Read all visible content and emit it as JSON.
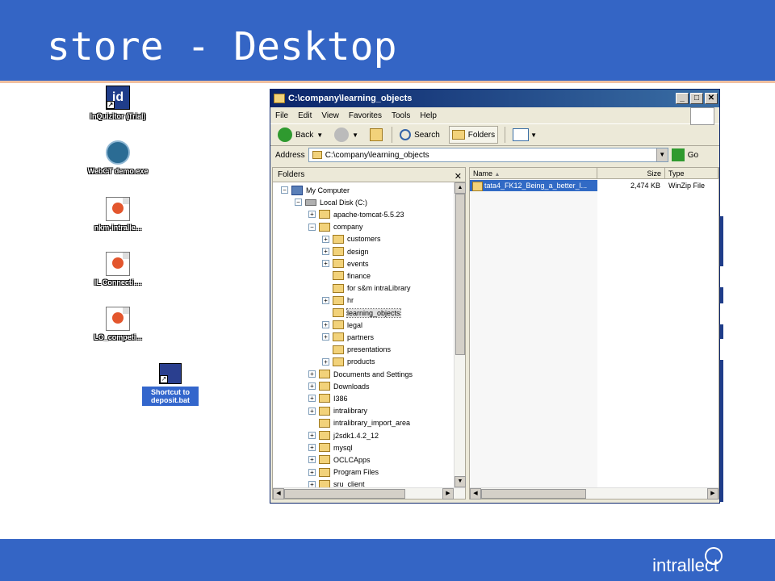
{
  "slide": {
    "title": "store - Desktop",
    "brand": "intrallect"
  },
  "desktop_icons": [
    {
      "label": "InQuizitor (Trial)",
      "icon": "inquizitor-icon"
    },
    {
      "label": "WebCT demo.exe",
      "icon": "webct-icon"
    },
    {
      "label": "nkm-intralle...",
      "icon": "powerpoint-file-icon"
    },
    {
      "label": "IL Connecti....",
      "icon": "powerpoint-file-icon"
    },
    {
      "label": "LO_competi...",
      "icon": "powerpoint-file-icon"
    },
    {
      "label": "Shortcut to deposit.bat",
      "icon": "batch-shortcut-icon"
    }
  ],
  "window": {
    "title": "C:\\company\\learning_objects",
    "menu": [
      "File",
      "Edit",
      "View",
      "Favorites",
      "Tools",
      "Help"
    ],
    "toolbar": {
      "back": "Back",
      "search": "Search",
      "folders": "Folders"
    },
    "address_label": "Address",
    "address_value": "C:\\company\\learning_objects",
    "go": "Go",
    "folders_header": "Folders",
    "columns": {
      "name": "Name",
      "size": "Size",
      "type": "Type"
    },
    "files": [
      {
        "name": "tata4_FK12_Being_a_better_l...",
        "size": "2,474 KB",
        "type": "WinZip File"
      }
    ],
    "tree": [
      {
        "label": "My Computer",
        "level": 0,
        "expander": "-",
        "kind": "computer"
      },
      {
        "label": "Local Disk (C:)",
        "level": 1,
        "expander": "-",
        "kind": "disk"
      },
      {
        "label": "apache-tomcat-5.5.23",
        "level": 2,
        "expander": "+",
        "kind": "folder"
      },
      {
        "label": "company",
        "level": 2,
        "expander": "-",
        "kind": "folder"
      },
      {
        "label": "customers",
        "level": 3,
        "expander": "+",
        "kind": "folder"
      },
      {
        "label": "design",
        "level": 3,
        "expander": "+",
        "kind": "folder"
      },
      {
        "label": "events",
        "level": 3,
        "expander": "+",
        "kind": "folder"
      },
      {
        "label": "finance",
        "level": 3,
        "expander": "",
        "kind": "folder"
      },
      {
        "label": "for s&m intraLibrary",
        "level": 3,
        "expander": "",
        "kind": "folder"
      },
      {
        "label": "hr",
        "level": 3,
        "expander": "+",
        "kind": "folder"
      },
      {
        "label": "learning_objects",
        "level": 3,
        "expander": "",
        "kind": "folder",
        "selected": true
      },
      {
        "label": "legal",
        "level": 3,
        "expander": "+",
        "kind": "folder"
      },
      {
        "label": "partners",
        "level": 3,
        "expander": "+",
        "kind": "folder"
      },
      {
        "label": "presentations",
        "level": 3,
        "expander": "",
        "kind": "folder"
      },
      {
        "label": "products",
        "level": 3,
        "expander": "+",
        "kind": "folder"
      },
      {
        "label": "Documents and Settings",
        "level": 2,
        "expander": "+",
        "kind": "folder"
      },
      {
        "label": "Downloads",
        "level": 2,
        "expander": "+",
        "kind": "folder"
      },
      {
        "label": "I386",
        "level": 2,
        "expander": "+",
        "kind": "folder"
      },
      {
        "label": "intralibrary",
        "level": 2,
        "expander": "+",
        "kind": "folder"
      },
      {
        "label": "intralibrary_import_area",
        "level": 2,
        "expander": "",
        "kind": "folder"
      },
      {
        "label": "j2sdk1.4.2_12",
        "level": 2,
        "expander": "+",
        "kind": "folder"
      },
      {
        "label": "mysql",
        "level": 2,
        "expander": "+",
        "kind": "folder"
      },
      {
        "label": "OCLCApps",
        "level": 2,
        "expander": "+",
        "kind": "folder"
      },
      {
        "label": "Program Files",
        "level": 2,
        "expander": "+",
        "kind": "folder"
      },
      {
        "label": "sru_client",
        "level": 2,
        "expander": "+",
        "kind": "folder"
      }
    ]
  },
  "colors": {
    "slide_blue": "#3465c5",
    "selection": "#316ac5",
    "title_bar": "#0a246a"
  }
}
